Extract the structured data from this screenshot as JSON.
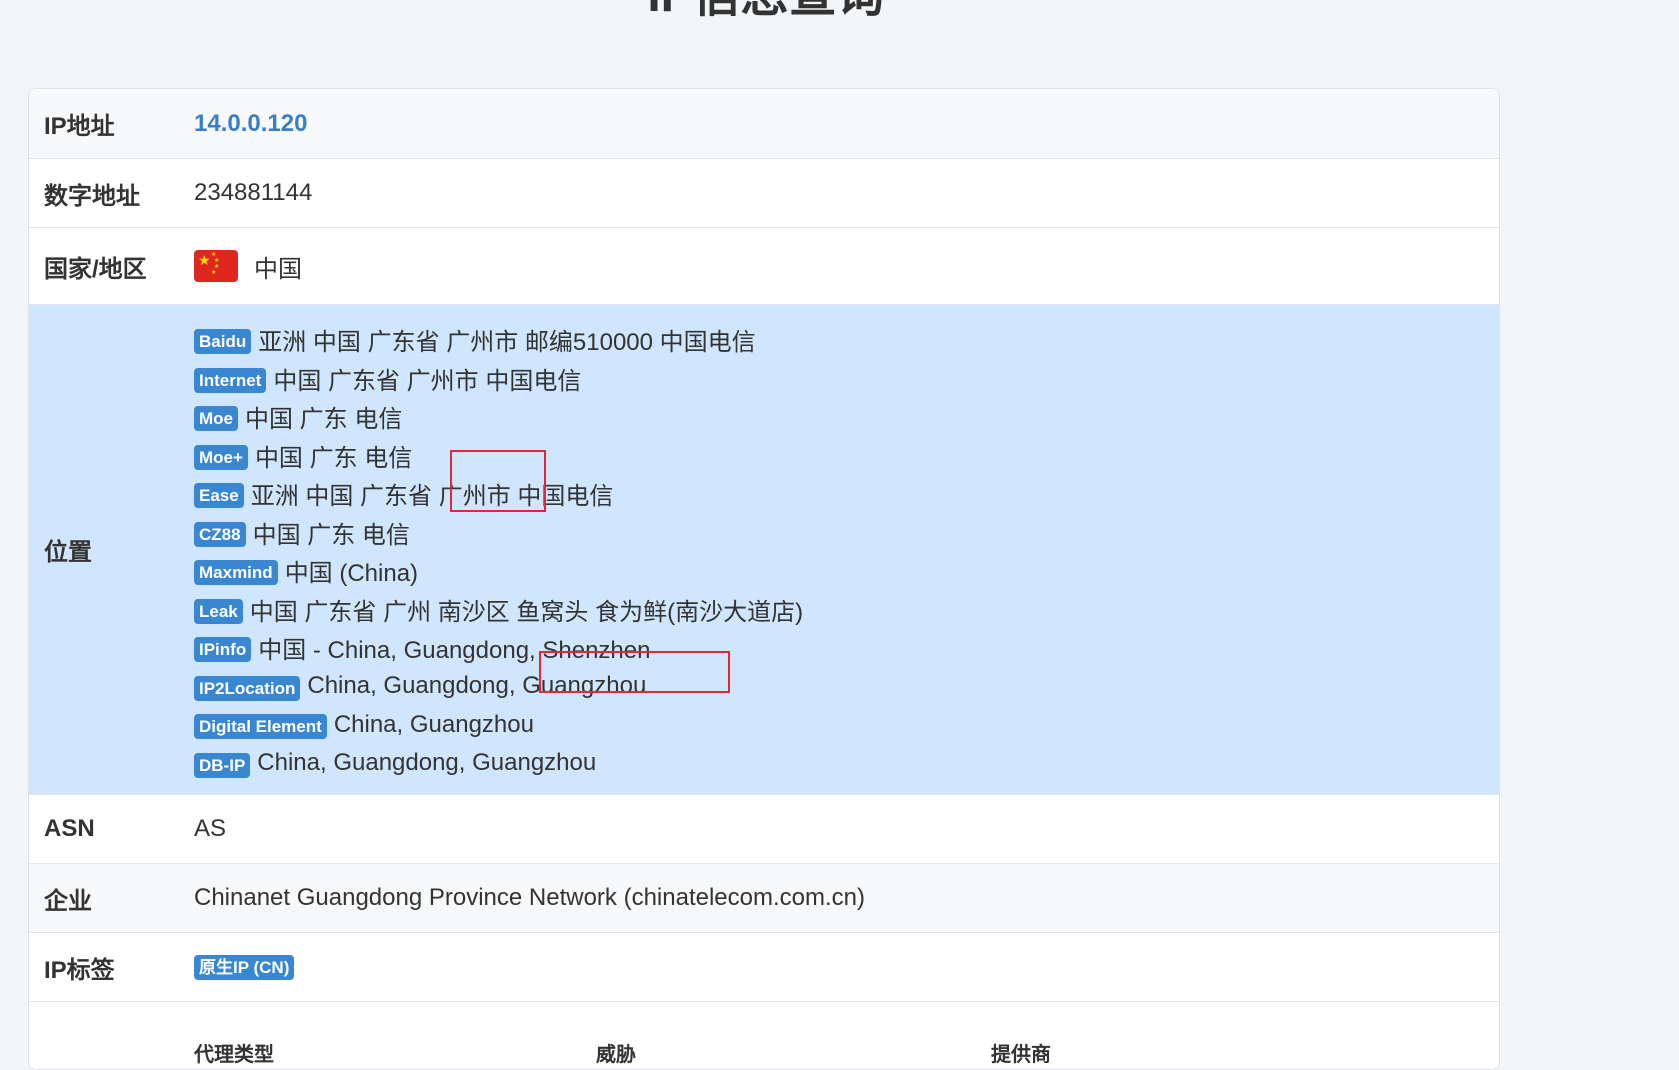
{
  "title": "IP信息查询",
  "rows": {
    "ip": {
      "label": "IP地址",
      "value": "14.0.0.120"
    },
    "numeric": {
      "label": "数字地址",
      "value": "234881144"
    },
    "country": {
      "label": "国家/地区",
      "value": "中国",
      "flag_icon": "china-flag-icon"
    },
    "location": {
      "label": "位置",
      "entries": [
        {
          "source": "Baidu",
          "text": "亚洲 中国 广东省 广州市 邮编510000 中国电信"
        },
        {
          "source": "Internet",
          "text": "中国 广东省 广州市 中国电信"
        },
        {
          "source": "Moe",
          "text": "中国 广东 电信"
        },
        {
          "source": "Moe+",
          "text": "中国 广东 电信"
        },
        {
          "source": "Ease",
          "text": "亚洲 中国 广东省 广州市 中国电信"
        },
        {
          "source": "CZ88",
          "text": "中国 广东 电信"
        },
        {
          "source": "Maxmind",
          "text": "中国 (China)"
        },
        {
          "source": "Leak",
          "text": "中国 广东省 广州 南沙区 鱼窝头 食为鲜(南沙大道店)"
        },
        {
          "source": "IPinfo",
          "text": "中国 - China, Guangdong, Shenzhen"
        },
        {
          "source": "IP2Location",
          "text": "China, Guangdong, Guangzhou"
        },
        {
          "source": "Digital Element",
          "text": "China, Guangzhou"
        },
        {
          "source": "DB-IP",
          "text": "China, Guangdong, Guangzhou"
        }
      ]
    },
    "asn": {
      "label": "ASN",
      "value": "AS"
    },
    "org": {
      "label": "企业",
      "value": "Chinanet Guangdong Province Network (chinatelecom.com.cn)"
    },
    "tags": {
      "label": "IP标签",
      "badge": "原生IP (CN)"
    },
    "more": {
      "col1": "代理类型",
      "col2": "威胁",
      "col3": "提供商"
    }
  },
  "colors": {
    "accent": "#3a87d1",
    "link": "#3a7fc4",
    "highlight_row": "#cfe6fc",
    "annotation": "#e0283a"
  }
}
